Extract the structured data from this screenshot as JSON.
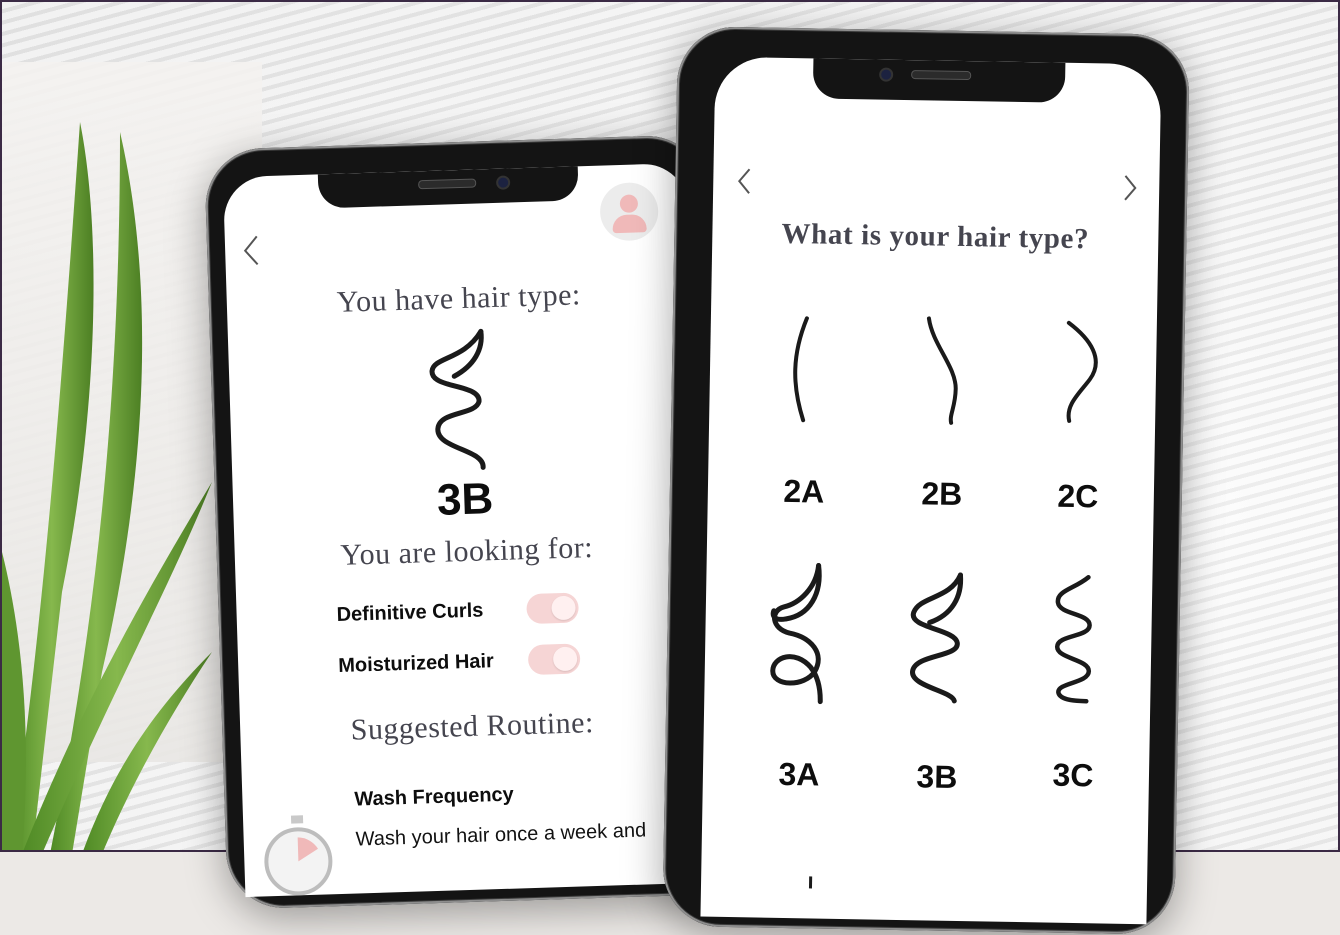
{
  "left_screen": {
    "title": "You have hair type:",
    "hair_type": "3B",
    "looking_for_title": "You are looking for:",
    "options": [
      {
        "label": "Definitive Curls",
        "enabled": true
      },
      {
        "label": "Moisturized Hair",
        "enabled": true
      }
    ],
    "routine_title": "Suggested Routine:",
    "routine_item_title": "Wash Frequency",
    "routine_item_text": "Wash your hair once a week and"
  },
  "right_screen": {
    "title": "What is your hair type?",
    "types": [
      {
        "label": "2A",
        "icon": "straight-wave-icon"
      },
      {
        "label": "2B",
        "icon": "s-wave-icon"
      },
      {
        "label": "2C",
        "icon": "tight-wave-icon"
      },
      {
        "label": "3A",
        "icon": "loose-curl-icon"
      },
      {
        "label": "3B",
        "icon": "curl-icon"
      },
      {
        "label": "3C",
        "icon": "tight-curl-icon"
      }
    ]
  },
  "colors": {
    "toggle_bg": "#f6d5d5",
    "heading": "#45454f",
    "leaf": "#5a8f2e"
  }
}
